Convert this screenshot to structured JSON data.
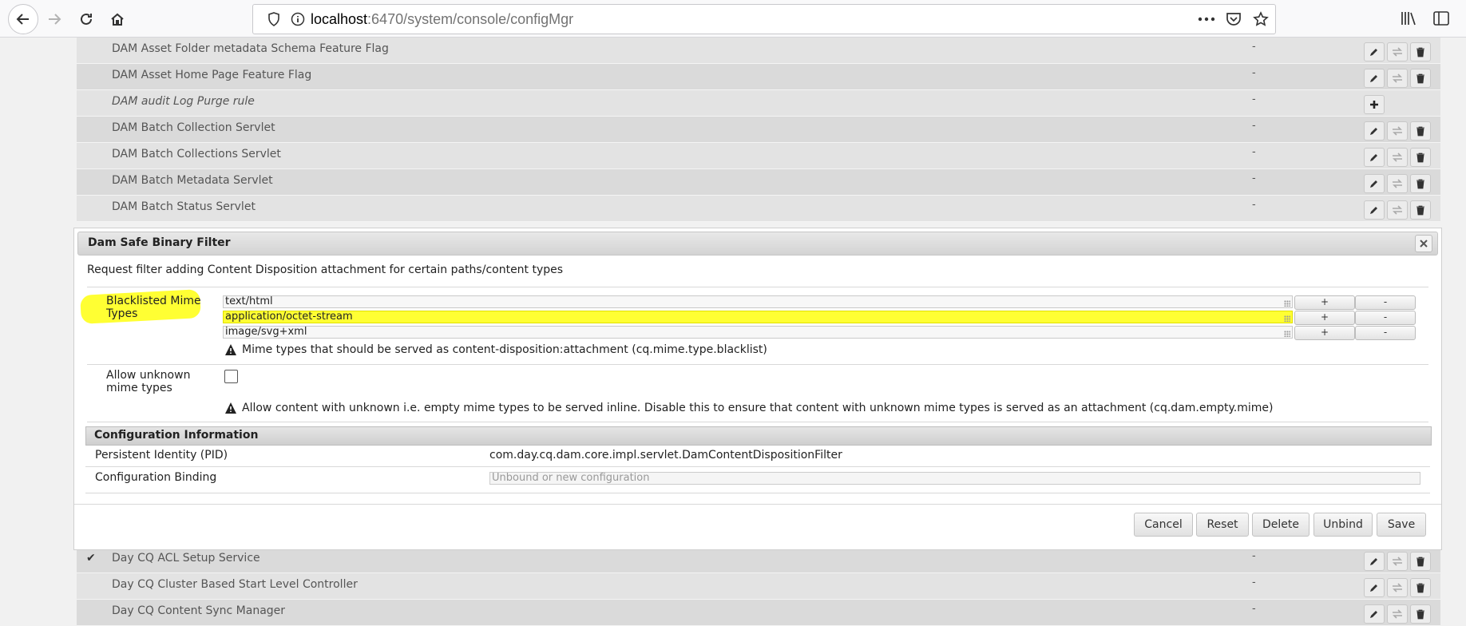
{
  "browser": {
    "url_host": "localhost",
    "url_rest": ":6470/system/console/configMgr"
  },
  "list_rows_top": [
    {
      "name": "DAM Asset Folder metadata Schema Feature Flag",
      "value": "-",
      "italic": false,
      "factory": false
    },
    {
      "name": "DAM Asset Home Page Feature Flag",
      "value": "-",
      "italic": false,
      "factory": false
    },
    {
      "name": "DAM audit Log Purge rule",
      "value": "-",
      "italic": true,
      "factory": true
    },
    {
      "name": "DAM Batch Collection Servlet",
      "value": "-",
      "italic": false,
      "factory": false
    },
    {
      "name": "DAM Batch Collections Servlet",
      "value": "-",
      "italic": false,
      "factory": false
    },
    {
      "name": "DAM Batch Metadata Servlet",
      "value": "-",
      "italic": false,
      "factory": false
    },
    {
      "name": "DAM Batch Status Servlet",
      "value": "-",
      "italic": false,
      "factory": false
    }
  ],
  "list_rows_bottom": [
    {
      "name": "Day CQ ACL Setup Service",
      "value": "-",
      "checked": true
    },
    {
      "name": "Day CQ Cluster Based Start Level Controller",
      "value": "-",
      "checked": false
    },
    {
      "name": "Day CQ Content Sync Manager",
      "value": "-",
      "checked": false
    }
  ],
  "dialog": {
    "title": "Dam Safe Binary Filter",
    "description": "Request filter adding Content Disposition attachment for certain paths/content types",
    "blacklist": {
      "label_line1": "Blacklisted Mime",
      "label_line2": "Types",
      "values": [
        "text/html",
        "application/octet-stream",
        "image/svg+xml"
      ],
      "add_label": "+",
      "remove_label": "-",
      "hint": "Mime types that should be served as content-disposition:attachment (cq.mime.type.blacklist)"
    },
    "allow_unknown": {
      "label_line1": "Allow unknown",
      "label_line2": "mime types",
      "checked": false,
      "hint": "Allow content with unknown i.e. empty mime types to be served inline. Disable this to ensure that content with unknown mime types is served as an attachment (cq.dam.empty.mime)"
    },
    "config_info": {
      "heading": "Configuration Information",
      "pid_label": "Persistent Identity (PID)",
      "pid_value": "com.day.cq.dam.core.impl.servlet.DamContentDispositionFilter",
      "binding_label": "Configuration Binding",
      "binding_placeholder": "Unbound or new configuration"
    },
    "buttons": {
      "cancel": "Cancel",
      "reset": "Reset",
      "delete": "Delete",
      "unbind": "Unbind",
      "save": "Save"
    }
  },
  "colors": {
    "highlight": "#ffff33"
  }
}
